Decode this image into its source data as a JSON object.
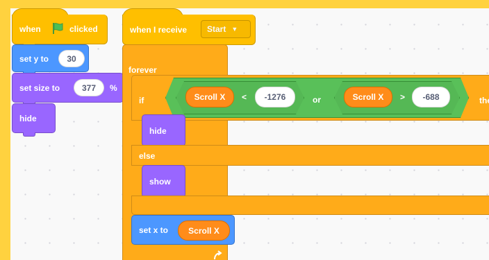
{
  "script1": {
    "hat_when": "when",
    "hat_clicked": "clicked",
    "set_y_label": "set y to",
    "set_y_value": "30",
    "set_size_label": "set size to",
    "set_size_value": "377",
    "set_size_unit": "%",
    "hide_label": "hide"
  },
  "script2": {
    "hat_label": "when I receive",
    "message": "Start",
    "forever_label": "forever",
    "if_label": "if",
    "left_reporter": "Scroll X",
    "left_operator": "<",
    "left_value": "-1276",
    "or_label": "or",
    "right_reporter": "Scroll X",
    "right_operator": ">",
    "right_value": "-688",
    "then_label": "then",
    "hide_label": "hide",
    "else_label": "else",
    "show_label": "show",
    "set_x_label": "set x to",
    "set_x_reporter": "Scroll X"
  },
  "colors": {
    "events": "#FFBF00",
    "motion": "#4C97FF",
    "looks": "#9966FF",
    "control": "#FFAB19",
    "operators": "#59C059",
    "variables": "#FF8C1A",
    "workspace_border": "#FFD23F"
  }
}
